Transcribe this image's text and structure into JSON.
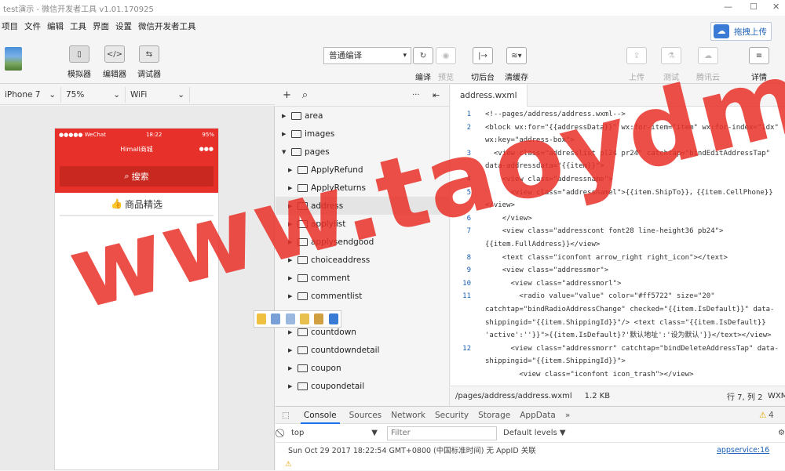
{
  "window": {
    "title": "test演示 - 微信开发者工具 v1.01.170925",
    "minimize": "—",
    "maximize": "☐",
    "close": "✕"
  },
  "menu": [
    "项目",
    "文件",
    "编辑",
    "工具",
    "界面",
    "设置",
    "微信开发者工具"
  ],
  "upload": {
    "label": "拖拽上传"
  },
  "toolbar": {
    "simulator": "模拟器",
    "editor": "编辑器",
    "debugger": "调试器",
    "compile_mode": "普通编译",
    "compile": "编译",
    "preview": "预览",
    "backend": "切后台",
    "clear_cache": "清缓存",
    "upload": "上传",
    "test": "测试",
    "tencent_cloud": "腾讯云",
    "details": "详情"
  },
  "device": {
    "model": "iPhone 7",
    "zoom": "75%",
    "network": "WiFi"
  },
  "phone": {
    "carrier": "●●●●● WeChat",
    "time": "18:22",
    "battery": "95%",
    "title": "Himall商城",
    "nav_dots": "●●●",
    "search": "搜索",
    "section": "商品精选"
  },
  "filetree": {
    "items": [
      {
        "name": "area",
        "level": 0,
        "open": false,
        "selected": false
      },
      {
        "name": "images",
        "level": 0,
        "open": false,
        "selected": false
      },
      {
        "name": "pages",
        "level": 0,
        "open": true,
        "selected": false
      },
      {
        "name": "ApplyRefund",
        "level": 1,
        "open": false,
        "selected": false
      },
      {
        "name": "ApplyReturns",
        "level": 1,
        "open": false,
        "selected": false
      },
      {
        "name": "address",
        "level": 1,
        "open": false,
        "selected": true
      },
      {
        "name": "applylist",
        "level": 1,
        "open": false,
        "selected": false
      },
      {
        "name": "applysendgood",
        "level": 1,
        "open": false,
        "selected": false
      },
      {
        "name": "choiceaddress",
        "level": 1,
        "open": false,
        "selected": false
      },
      {
        "name": "comment",
        "level": 1,
        "open": false,
        "selected": false
      },
      {
        "name": "commentlist",
        "level": 1,
        "open": false,
        "selected": false
      },
      {
        "name": "",
        "level": 1,
        "open": false,
        "selected": false
      },
      {
        "name": "countdown",
        "level": 1,
        "open": false,
        "selected": false
      },
      {
        "name": "countdowndetail",
        "level": 1,
        "open": false,
        "selected": false
      },
      {
        "name": "coupon",
        "level": 1,
        "open": false,
        "selected": false
      },
      {
        "name": "coupondetail",
        "level": 1,
        "open": false,
        "selected": false
      }
    ]
  },
  "editor": {
    "tab": "address.wxml",
    "lines": [
      {
        "n": "1",
        "code": "<!--pages/address/address.wxml-->"
      },
      {
        "n": "2",
        "code": "<block wx:for=\"{{addressData}}\" wx:for-item=\"item\" wx:for-index=\"idx\" wx:key=\"address-box\">"
      },
      {
        "n": "3",
        "code": "  <view class=\"addresslist pl24 pr24\" catchtap=\"bindEditAddressTap\" data-addressdata=\"{{item}}\">"
      },
      {
        "n": "4",
        "code": "    <view class=\"addressname\">"
      },
      {
        "n": "5",
        "code": "      <view class=\"addressnamel\">{{item.ShipTo}}，{{item.CellPhone}}</view>"
      },
      {
        "n": "6",
        "code": "    </view>"
      },
      {
        "n": "7",
        "code": "    <view class=\"addresscont font28 line-height36 pb24\">{{item.FullAddress}}</view>"
      },
      {
        "n": "8",
        "code": "    <text class=\"iconfont arrow_right right_icon\"></text>"
      },
      {
        "n": "9",
        "code": "    <view class=\"addressmor\">"
      },
      {
        "n": "10",
        "code": "      <view class=\"addressmorl\">"
      },
      {
        "n": "11",
        "code": "        <radio value=\"value\" color=\"#ff5722\" size=\"20\" catchtap=\"bindRadioAddressChange\" checked=\"{{item.IsDefault}}\" data-shippingid=\"{{item.ShippingId}}\"/> <text class=\"{{item.IsDefault}} 'active':''}}\">{{item.IsDefault}?'默认地址':'设为默认'}}</text></view>"
      },
      {
        "n": "12",
        "code": "      <view class=\"addressmorr\" catchtap=\"bindDeleteAddressTap\" data-shippingid=\"{{item.ShippingId}}\">"
      },
      {
        "n": "",
        "code": "        <view class=\"iconfont icon_trash\"></view>"
      }
    ],
    "path": "/pages/address/address.wxml",
    "size": "1.2 KB",
    "position": "行 7, 列 2",
    "lang": "WXM"
  },
  "console": {
    "tabs": [
      "Console",
      "Sources",
      "Network",
      "Security",
      "Storage",
      "AppData",
      "»"
    ],
    "warnings": "4",
    "context": "top",
    "filter_placeholder": "Filter",
    "levels": "Default levels ▼",
    "message": "Sun Oct 29 2017 18:22:54 GMT+0800 (中国标准时间) 无 AppID 关联",
    "source": "appservice:16"
  },
  "watermark": "www.taoydm.com",
  "colors": {
    "phone_red": "#e8302a",
    "link_blue": "#1a5fb4"
  }
}
